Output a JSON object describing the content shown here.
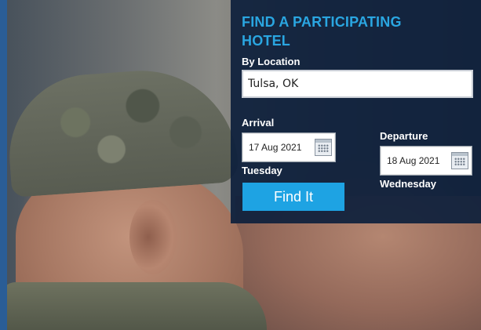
{
  "panel": {
    "title_line1": "FIND A PARTICIPATING",
    "title_line2": "HOTEL",
    "location_label": "By Location",
    "location_value": "Tulsa, OK",
    "arrival": {
      "label": "Arrival",
      "date": "17 Aug 2021",
      "weekday": "Tuesday"
    },
    "departure": {
      "label": "Departure",
      "date": "18 Aug 2021",
      "weekday": "Wednesday"
    },
    "button_label": "Find It"
  },
  "icons": {
    "arrival_calendar": "calendar-icon",
    "departure_calendar": "calendar-icon"
  },
  "colors": {
    "accent": "#2aa6e1",
    "button": "#1ea3e3",
    "panel_bg": "#0e203c"
  }
}
